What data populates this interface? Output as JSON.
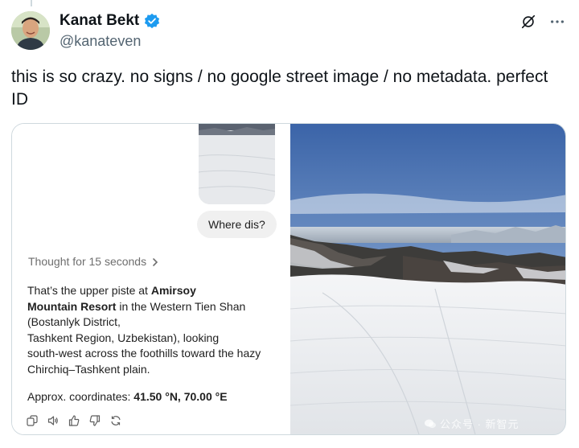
{
  "author": {
    "display_name": "Kanat Bekt",
    "handle": "@kanateven",
    "verified": true
  },
  "tweet": {
    "text": "this is so crazy. no signs / no google street image / no metadata. perfect ID"
  },
  "chat": {
    "user_prompt": "Where dis?",
    "thought_label": "Thought for 15 seconds",
    "answer_part1": "That’s the upper piste at ",
    "answer_bold1": "Amirsoy",
    "answer_bold2": "Mountain Resort",
    "answer_part2": " in the Western Tien Shan",
    "answer_line3": "(Bostanlyk District,",
    "answer_line4": "Tashkent Region, Uzbekistan), looking",
    "answer_line5": "south-west across the foothills toward the hazy",
    "answer_line6": "Chirchiq–Tashkent plain.",
    "coords_label": "Approx. coordinates: ",
    "coords_value": "41.50 °N, 70.00 °E"
  },
  "watermark": {
    "text": "公众号 · 新智元"
  },
  "icons": [
    "verified-badge-icon",
    "grok-icon",
    "more-icon",
    "chevron-right-icon",
    "copy-icon",
    "speaker-icon",
    "thumbs-up-icon",
    "thumbs-down-icon",
    "regenerate-icon"
  ],
  "colors": {
    "verified": "#1d9bf0",
    "handle": "#536471",
    "text": "#0f1419"
  }
}
